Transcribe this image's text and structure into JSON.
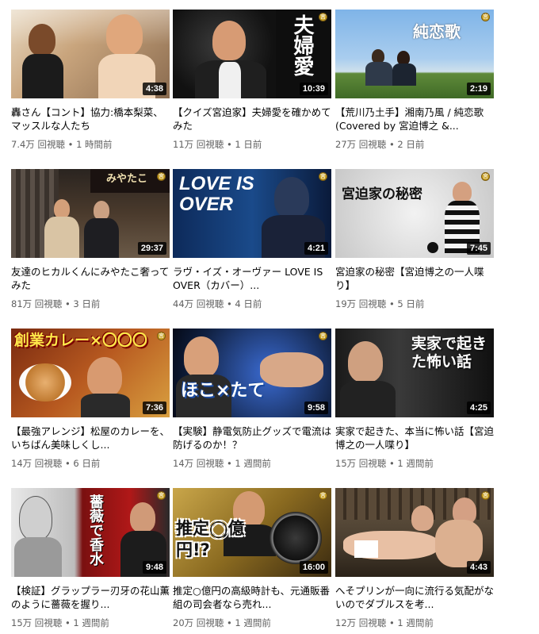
{
  "videos": [
    {
      "title": "轟さん【コント】協力:橋本梨菜、マッスルな人たち",
      "duration": "4:38",
      "views": "7.4万 回視聴",
      "age": "1 時間前",
      "overlay": ""
    },
    {
      "title": "【クイズ宮迫家】夫婦愛を確かめてみた",
      "duration": "10:39",
      "views": "11万 回視聴",
      "age": "1 日前",
      "overlay": "夫婦愛"
    },
    {
      "title": "【荒川乃土手】湘南乃風 / 純恋歌(Covered by 宮迫博之 &...",
      "duration": "2:19",
      "views": "27万 回視聴",
      "age": "2 日前",
      "overlay": "純恋歌"
    },
    {
      "title": "友達のヒカルくんにみやたこ奢ってみた",
      "duration": "29:37",
      "views": "81万 回視聴",
      "age": "3 日前",
      "overlay": "みやたこ"
    },
    {
      "title": "ラヴ・イズ・オーヴァー LOVE IS OVER（カバー）...",
      "duration": "4:21",
      "views": "44万 回視聴",
      "age": "4 日前",
      "overlay": "LOVE IS OVER"
    },
    {
      "title": "宮迫家の秘密【宮迫博之の一人喋り】",
      "duration": "7:45",
      "views": "19万 回視聴",
      "age": "5 日前",
      "overlay": "宮迫家の秘密"
    },
    {
      "title": "【最強アレンジ】松屋のカレーを、いちばん美味しくし...",
      "duration": "7:36",
      "views": "14万 回視聴",
      "age": "6 日前",
      "overlay": "創業カレー×〇〇〇"
    },
    {
      "title": "【実験】静電気防止グッズで電流は防げるのか！？",
      "duration": "9:58",
      "views": "14万 回視聴",
      "age": "1 週間前",
      "overlay": "ほこ×たて"
    },
    {
      "title": "実家で起きた、本当に怖い話【宮迫博之の一人喋り】",
      "duration": "4:25",
      "views": "15万 回視聴",
      "age": "1 週間前",
      "overlay": "実家で起きた怖い話"
    },
    {
      "title": "【検証】グラップラー刃牙の花山薫のように薔薇を握り...",
      "duration": "9:48",
      "views": "15万 回視聴",
      "age": "1 週間前",
      "overlay": "薔薇で香水"
    },
    {
      "title": "推定○億円の高級時計も、元通販番組の司会者なら売れ...",
      "duration": "16:00",
      "views": "20万 回視聴",
      "age": "1 週間前",
      "overlay": "推定◯億円!?"
    },
    {
      "title": "へそプリンが一向に流行る気配がないのでダブルスを考...",
      "duration": "4:43",
      "views": "12万 回視聴",
      "age": "1 週間前",
      "overlay": ""
    }
  ],
  "separator": " • "
}
